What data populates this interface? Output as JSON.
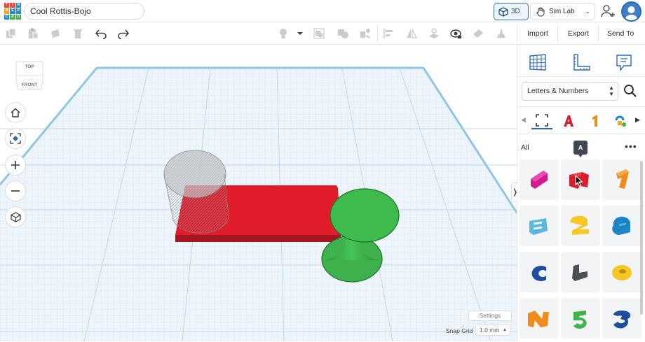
{
  "app": {
    "design_name": "Cool Rottis-Bojo",
    "logo_letters": [
      "T",
      "I",
      "N",
      "K",
      "E",
      "R",
      "C",
      "A",
      "D"
    ]
  },
  "header": {
    "view_mode_label": "3D",
    "simlab_label": "Sim Lab"
  },
  "toolbar": {
    "import_label": "Import",
    "export_label": "Export",
    "sendto_label": "Send To"
  },
  "viewcube": {
    "top_label": "TOP",
    "front_label": "FRONT"
  },
  "viewport": {
    "settings_label": "Settings",
    "snap_grid_label": "Snap Grid",
    "snap_grid_value": "1.0 mm"
  },
  "library": {
    "category": "Letters & Numbers",
    "filter_label": "All",
    "tooltip": "A"
  },
  "colors": {
    "accent": "#2a6bb0",
    "box_red": "#e0202b",
    "cylinder_hole": "#9a9ea4",
    "cone_green": "#3db54a",
    "grid_bg": "#eef5fa",
    "grid_line": "#c9deeb"
  }
}
